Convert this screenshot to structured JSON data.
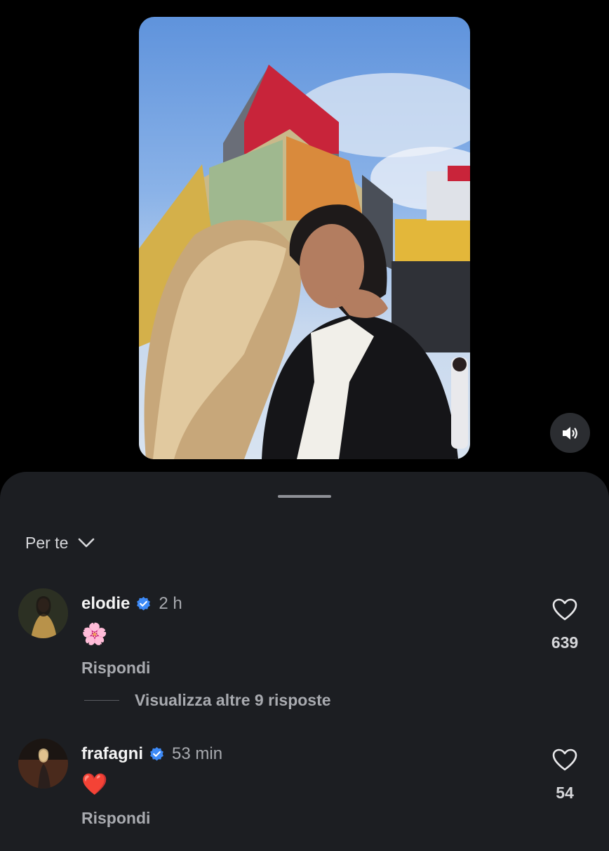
{
  "sheet": {
    "sort_label": "Per te"
  },
  "comments": [
    {
      "username": "elodie",
      "time": "2 h",
      "text": "🌸",
      "reply_label": "Rispondi",
      "likes": "639"
    },
    {
      "username": "frafagni",
      "time": "53 min",
      "text": "❤️",
      "reply_label": "Rispondi",
      "likes": "54"
    }
  ],
  "replies_link": "Visualizza altre 9 risposte",
  "icons": {
    "audio": "speaker-icon",
    "verified": "verified-badge-icon",
    "sort": "chevron-down-icon",
    "like": "heart-icon"
  },
  "colors": {
    "background": "#000000",
    "sheet": "#1c1e22",
    "verified": "#3d8af7",
    "secondary_text": "#a8aaaf"
  }
}
